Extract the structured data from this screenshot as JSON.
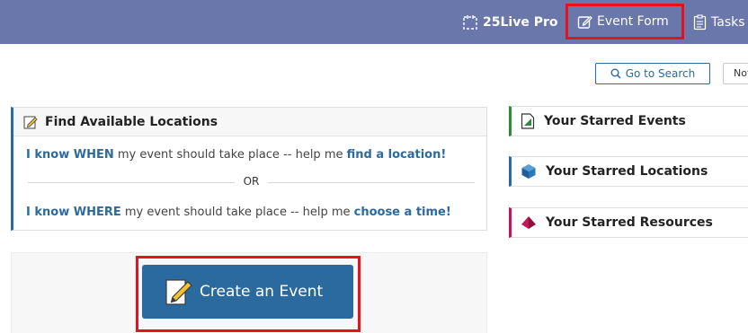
{
  "nav": {
    "brand": "25Live Pro",
    "event_form": "Event Form",
    "tasks": "Tasks"
  },
  "search": {
    "go_to_search": "Go to Search",
    "notifications": "Not"
  },
  "find_panel": {
    "title": "Find Available Locations",
    "when_lead": "I know WHEN",
    "when_mid": " my event should take place -- help me ",
    "when_link": "find a location!",
    "or": "OR",
    "where_lead": "I know WHERE",
    "where_mid": " my event should take place -- help me ",
    "where_link": "choose a time!"
  },
  "create": {
    "label": "Create an Event"
  },
  "starred": {
    "events": "Your Starred Events",
    "locations": "Your Starred Locations",
    "resources": "Your Starred Resources"
  },
  "colors": {
    "nav_bg": "#6977aa",
    "primary": "#2b6a9f",
    "highlight": "#e8121d",
    "events_accent": "#2e8b3e",
    "resources_accent": "#c2185b"
  }
}
